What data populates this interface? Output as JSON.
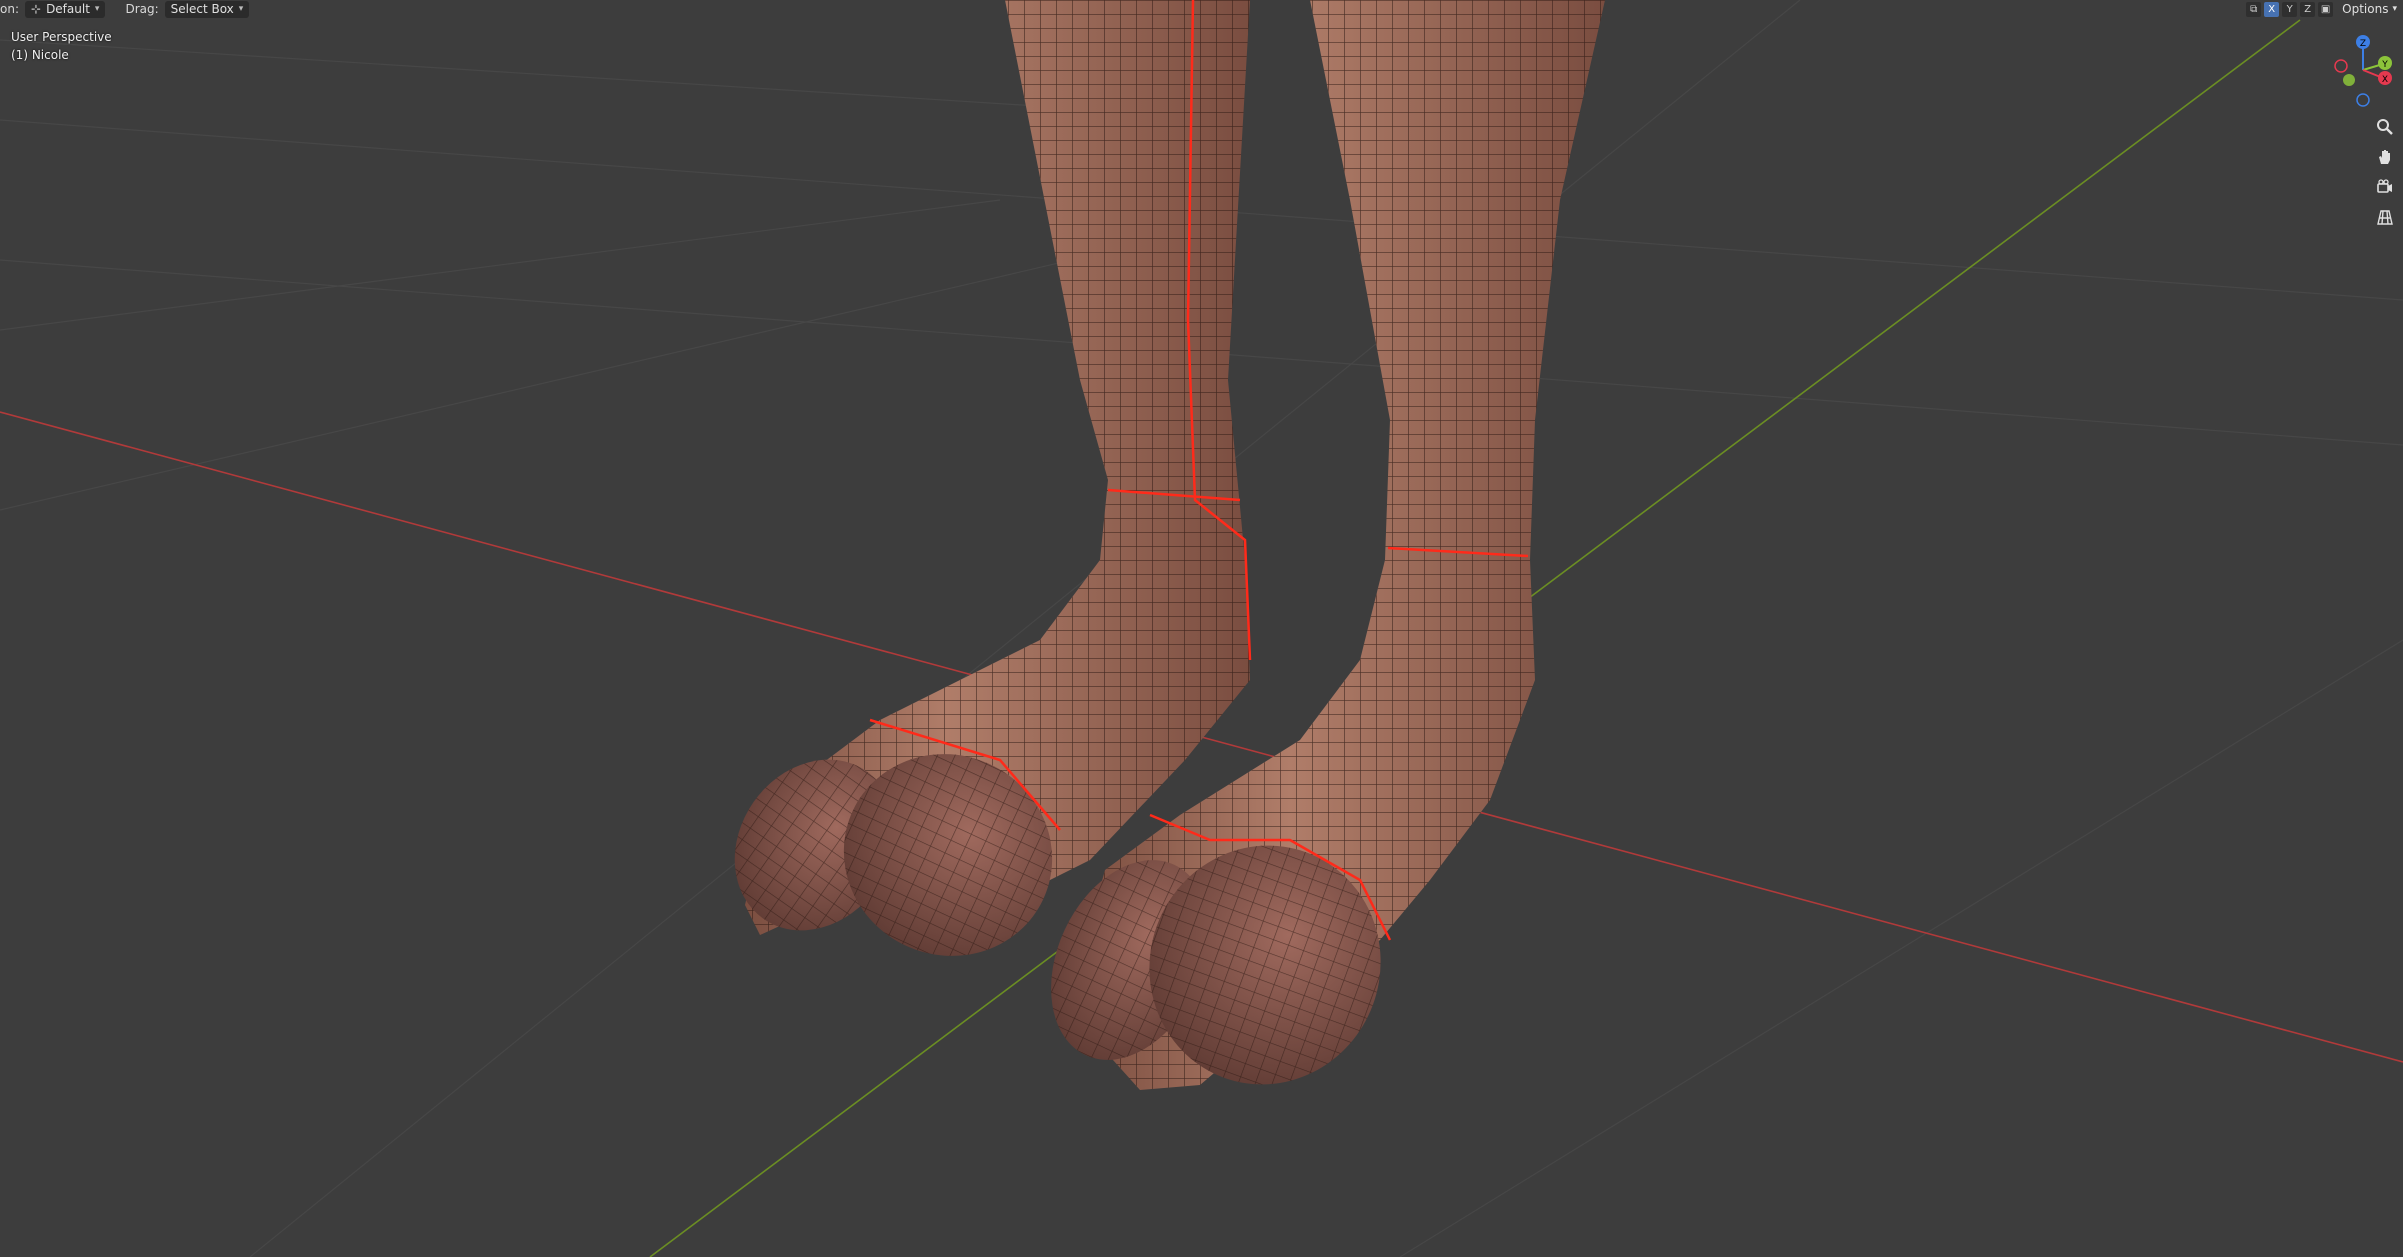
{
  "header": {
    "orientation_label": "on:",
    "orientation_value": "Default",
    "drag_label": "Drag:",
    "drag_value": "Select Box",
    "axis_buttons": [
      "X",
      "Y",
      "Z"
    ],
    "options_label": "Options"
  },
  "overlay": {
    "perspective": "User Perspective",
    "object": "(1) Nicole"
  },
  "gizmo": {
    "axes": [
      "X",
      "Y",
      "Z"
    ],
    "colors": {
      "x": "#e5394f",
      "y": "#8cc43a",
      "z": "#3d7fe5"
    }
  },
  "navigation": [
    "zoom-icon",
    "pan-hand-icon",
    "camera-icon",
    "grid-ortho-icon"
  ],
  "scene": {
    "x_axis_color": "#b13a3a",
    "y_axis_color": "#6b8e23",
    "grid_color": "#474747",
    "mesh_color": "#a16c5a",
    "seam_color": "#ff2a1a",
    "wire_color": "#2a1711"
  }
}
